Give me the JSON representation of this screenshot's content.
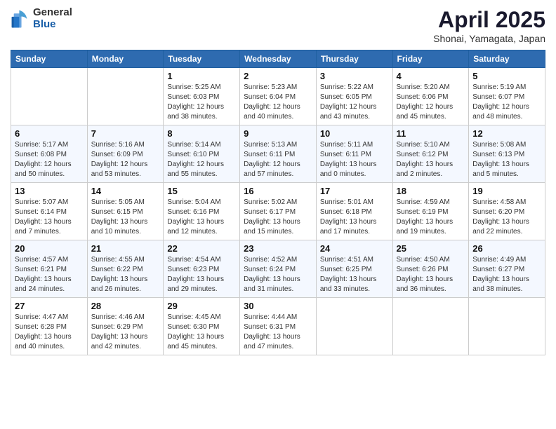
{
  "header": {
    "logo_general": "General",
    "logo_blue": "Blue",
    "title": "April 2025",
    "location": "Shonai, Yamagata, Japan"
  },
  "weekdays": [
    "Sunday",
    "Monday",
    "Tuesday",
    "Wednesday",
    "Thursday",
    "Friday",
    "Saturday"
  ],
  "weeks": [
    [
      {
        "day": "",
        "sunrise": "",
        "sunset": "",
        "daylight": ""
      },
      {
        "day": "",
        "sunrise": "",
        "sunset": "",
        "daylight": ""
      },
      {
        "day": "1",
        "sunrise": "Sunrise: 5:25 AM",
        "sunset": "Sunset: 6:03 PM",
        "daylight": "Daylight: 12 hours and 38 minutes."
      },
      {
        "day": "2",
        "sunrise": "Sunrise: 5:23 AM",
        "sunset": "Sunset: 6:04 PM",
        "daylight": "Daylight: 12 hours and 40 minutes."
      },
      {
        "day": "3",
        "sunrise": "Sunrise: 5:22 AM",
        "sunset": "Sunset: 6:05 PM",
        "daylight": "Daylight: 12 hours and 43 minutes."
      },
      {
        "day": "4",
        "sunrise": "Sunrise: 5:20 AM",
        "sunset": "Sunset: 6:06 PM",
        "daylight": "Daylight: 12 hours and 45 minutes."
      },
      {
        "day": "5",
        "sunrise": "Sunrise: 5:19 AM",
        "sunset": "Sunset: 6:07 PM",
        "daylight": "Daylight: 12 hours and 48 minutes."
      }
    ],
    [
      {
        "day": "6",
        "sunrise": "Sunrise: 5:17 AM",
        "sunset": "Sunset: 6:08 PM",
        "daylight": "Daylight: 12 hours and 50 minutes."
      },
      {
        "day": "7",
        "sunrise": "Sunrise: 5:16 AM",
        "sunset": "Sunset: 6:09 PM",
        "daylight": "Daylight: 12 hours and 53 minutes."
      },
      {
        "day": "8",
        "sunrise": "Sunrise: 5:14 AM",
        "sunset": "Sunset: 6:10 PM",
        "daylight": "Daylight: 12 hours and 55 minutes."
      },
      {
        "day": "9",
        "sunrise": "Sunrise: 5:13 AM",
        "sunset": "Sunset: 6:11 PM",
        "daylight": "Daylight: 12 hours and 57 minutes."
      },
      {
        "day": "10",
        "sunrise": "Sunrise: 5:11 AM",
        "sunset": "Sunset: 6:11 PM",
        "daylight": "Daylight: 13 hours and 0 minutes."
      },
      {
        "day": "11",
        "sunrise": "Sunrise: 5:10 AM",
        "sunset": "Sunset: 6:12 PM",
        "daylight": "Daylight: 13 hours and 2 minutes."
      },
      {
        "day": "12",
        "sunrise": "Sunrise: 5:08 AM",
        "sunset": "Sunset: 6:13 PM",
        "daylight": "Daylight: 13 hours and 5 minutes."
      }
    ],
    [
      {
        "day": "13",
        "sunrise": "Sunrise: 5:07 AM",
        "sunset": "Sunset: 6:14 PM",
        "daylight": "Daylight: 13 hours and 7 minutes."
      },
      {
        "day": "14",
        "sunrise": "Sunrise: 5:05 AM",
        "sunset": "Sunset: 6:15 PM",
        "daylight": "Daylight: 13 hours and 10 minutes."
      },
      {
        "day": "15",
        "sunrise": "Sunrise: 5:04 AM",
        "sunset": "Sunset: 6:16 PM",
        "daylight": "Daylight: 13 hours and 12 minutes."
      },
      {
        "day": "16",
        "sunrise": "Sunrise: 5:02 AM",
        "sunset": "Sunset: 6:17 PM",
        "daylight": "Daylight: 13 hours and 15 minutes."
      },
      {
        "day": "17",
        "sunrise": "Sunrise: 5:01 AM",
        "sunset": "Sunset: 6:18 PM",
        "daylight": "Daylight: 13 hours and 17 minutes."
      },
      {
        "day": "18",
        "sunrise": "Sunrise: 4:59 AM",
        "sunset": "Sunset: 6:19 PM",
        "daylight": "Daylight: 13 hours and 19 minutes."
      },
      {
        "day": "19",
        "sunrise": "Sunrise: 4:58 AM",
        "sunset": "Sunset: 6:20 PM",
        "daylight": "Daylight: 13 hours and 22 minutes."
      }
    ],
    [
      {
        "day": "20",
        "sunrise": "Sunrise: 4:57 AM",
        "sunset": "Sunset: 6:21 PM",
        "daylight": "Daylight: 13 hours and 24 minutes."
      },
      {
        "day": "21",
        "sunrise": "Sunrise: 4:55 AM",
        "sunset": "Sunset: 6:22 PM",
        "daylight": "Daylight: 13 hours and 26 minutes."
      },
      {
        "day": "22",
        "sunrise": "Sunrise: 4:54 AM",
        "sunset": "Sunset: 6:23 PM",
        "daylight": "Daylight: 13 hours and 29 minutes."
      },
      {
        "day": "23",
        "sunrise": "Sunrise: 4:52 AM",
        "sunset": "Sunset: 6:24 PM",
        "daylight": "Daylight: 13 hours and 31 minutes."
      },
      {
        "day": "24",
        "sunrise": "Sunrise: 4:51 AM",
        "sunset": "Sunset: 6:25 PM",
        "daylight": "Daylight: 13 hours and 33 minutes."
      },
      {
        "day": "25",
        "sunrise": "Sunrise: 4:50 AM",
        "sunset": "Sunset: 6:26 PM",
        "daylight": "Daylight: 13 hours and 36 minutes."
      },
      {
        "day": "26",
        "sunrise": "Sunrise: 4:49 AM",
        "sunset": "Sunset: 6:27 PM",
        "daylight": "Daylight: 13 hours and 38 minutes."
      }
    ],
    [
      {
        "day": "27",
        "sunrise": "Sunrise: 4:47 AM",
        "sunset": "Sunset: 6:28 PM",
        "daylight": "Daylight: 13 hours and 40 minutes."
      },
      {
        "day": "28",
        "sunrise": "Sunrise: 4:46 AM",
        "sunset": "Sunset: 6:29 PM",
        "daylight": "Daylight: 13 hours and 42 minutes."
      },
      {
        "day": "29",
        "sunrise": "Sunrise: 4:45 AM",
        "sunset": "Sunset: 6:30 PM",
        "daylight": "Daylight: 13 hours and 45 minutes."
      },
      {
        "day": "30",
        "sunrise": "Sunrise: 4:44 AM",
        "sunset": "Sunset: 6:31 PM",
        "daylight": "Daylight: 13 hours and 47 minutes."
      },
      {
        "day": "",
        "sunrise": "",
        "sunset": "",
        "daylight": ""
      },
      {
        "day": "",
        "sunrise": "",
        "sunset": "",
        "daylight": ""
      },
      {
        "day": "",
        "sunrise": "",
        "sunset": "",
        "daylight": ""
      }
    ]
  ]
}
